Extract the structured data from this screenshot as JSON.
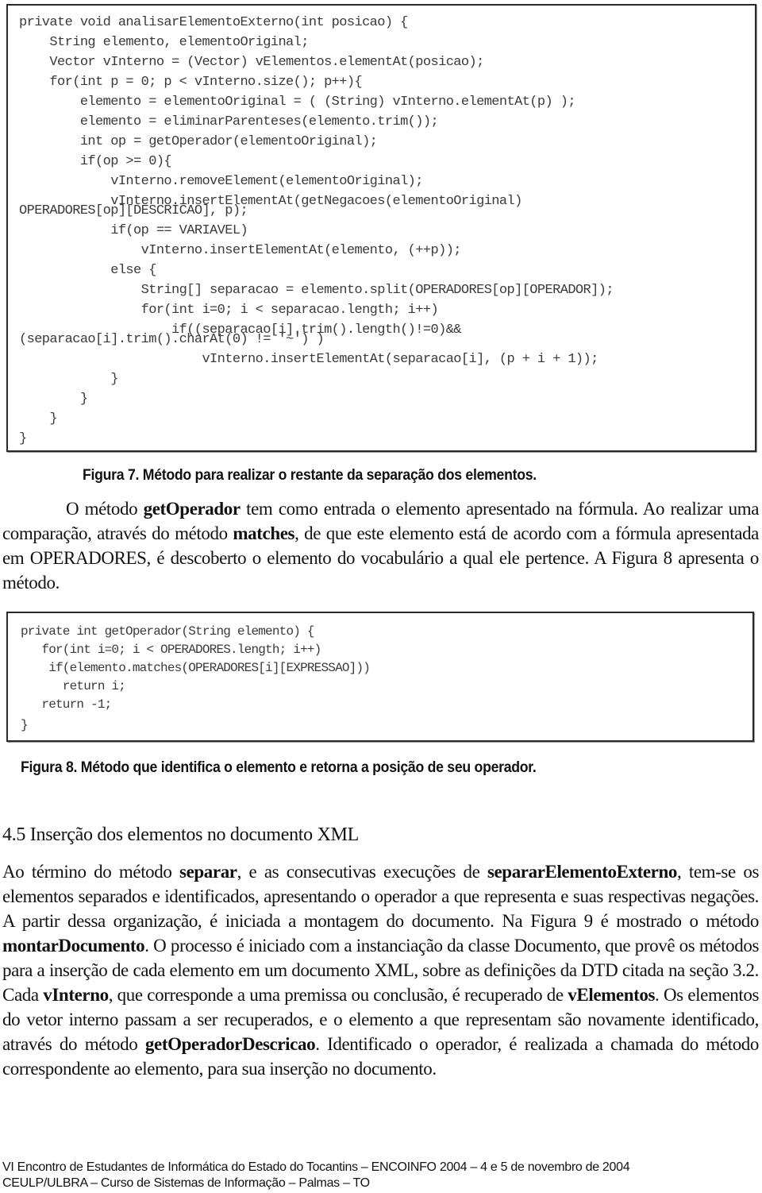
{
  "figure7": {
    "code_lines": [
      "private void analisarElementoExterno(int posicao) {",
      "    String elemento, elementoOriginal;",
      "    Vector vInterno = (Vector) vElementos.elementAt(posicao);",
      "    for(int p = 0; p < vInterno.size(); p++){",
      "        elemento = elementoOriginal = ( (String) vInterno.elementAt(p) );",
      "        elemento = eliminarParenteses(elemento.trim());",
      "        int op = getOperador(elementoOriginal);",
      "        if(op >= 0){",
      "            vInterno.removeElement(elementoOriginal);",
      "            vInterno.insertElementAt(getNegacoes(elementoOriginal)",
      "OPERADORES[op][DESCRICAO], p);",
      "            if(op == VARIAVEL)",
      "                vInterno.insertElementAt(elemento, (++p));",
      "            else {",
      "                String[] separacao = elemento.split(OPERADORES[op][OPERADOR]);",
      "                for(int i=0; i < separacao.length; i++)",
      "                    if((separacao[i].trim().length()!=0)&&",
      "(separacao[i].trim().charAt(0) != '~') )",
      "                        vInterno.insertElementAt(separacao[i], (p + i + 1));",
      "            }",
      "        }",
      "    }",
      "}"
    ],
    "caption": "Figura 7. Método para realizar o restante da separação dos elementos."
  },
  "paragraph1": {
    "parts": [
      {
        "text": "O método ",
        "bold": false
      },
      {
        "text": "getOperador",
        "bold": true
      },
      {
        "text": " tem como entrada o elemento apresentado na fórmula. Ao realizar uma comparação, através do método ",
        "bold": false
      },
      {
        "text": "matches",
        "bold": true
      },
      {
        "text": ", de que este elemento está de acordo com a fórmula apresentada em OPERADORES, é descoberto o elemento do vocabulário a qual ele pertence. A Figura 8 apresenta o método.",
        "bold": false
      }
    ]
  },
  "figure8": {
    "code_lines": [
      "private int getOperador(String elemento) {",
      "   for(int i=0; i < OPERADORES.length; i++)",
      "    if(elemento.matches(OPERADORES[i][EXPRESSAO]))",
      "      return i;",
      "   return -1;",
      "}"
    ],
    "caption": "Figura 8. Método que identifica o elemento e retorna a posição de seu operador."
  },
  "section": {
    "heading": "4.5 Inserção dos elementos no documento XML"
  },
  "paragraph2": {
    "parts": [
      {
        "text": "Ao término do método ",
        "bold": false
      },
      {
        "text": "separar",
        "bold": true
      },
      {
        "text": ", e as consecutivas execuções de ",
        "bold": false
      },
      {
        "text": "separarElementoExterno",
        "bold": true
      },
      {
        "text": ", tem-se os elementos separados e identificados, apresentando o operador a que representa e suas respectivas negações. A partir dessa organização, é iniciada a montagem do documento. Na Figura 9 é mostrado o método ",
        "bold": false
      },
      {
        "text": "montarDocumento",
        "bold": true
      },
      {
        "text": ". O processo é iniciado com a instanciação da classe Documento, que provê os métodos para a inserção de cada elemento em um documento XML, sobre as definições da DTD citada na seção 3.2. Cada ",
        "bold": false
      },
      {
        "text": "vInterno",
        "bold": true
      },
      {
        "text": ", que corresponde a uma premissa ou conclusão, é recuperado de ",
        "bold": false
      },
      {
        "text": "vElementos",
        "bold": true
      },
      {
        "text": ". Os elementos do vetor interno passam a ser recuperados, e o elemento a que representam são novamente identificado, através do método ",
        "bold": false
      },
      {
        "text": "getOperadorDescricao",
        "bold": true
      },
      {
        "text": ". Identificado o operador, é realizada a chamada do método correspondente ao elemento, para sua inserção no documento.",
        "bold": false
      }
    ]
  },
  "footer": {
    "line1": "VI Encontro de Estudantes de Informática do Estado do Tocantins – ENCOINFO 2004 –  4 e 5 de novembro de 2004",
    "line2": "CEULP/ULBRA – Curso de Sistemas de Informação – Palmas  –  TO"
  }
}
